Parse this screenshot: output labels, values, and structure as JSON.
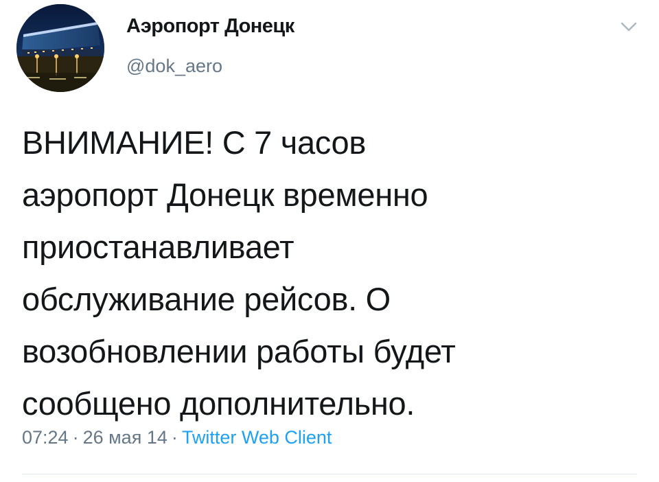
{
  "tweet": {
    "author": {
      "display_name": "Аэропорт Донецк",
      "handle": "@dok_aero",
      "avatar_icon": "airport-terminal-photo"
    },
    "menu_icon": "chevron-down-icon",
    "text_lines": [
      "ВНИМАНИЕ! С 7 часов",
      "аэропорт Донецк временно",
      "приостанавливает",
      "обслуживание рейсов. О",
      "возобновлении работы будет",
      "сообщено дополнительно."
    ],
    "time": "07:24",
    "date": "26 мая 14",
    "separator": "·",
    "client": "Twitter Web Client"
  },
  "colors": {
    "text": "#14171a",
    "muted": "#657786",
    "link": "#1da1f2",
    "divider": "#e1e8ed"
  }
}
